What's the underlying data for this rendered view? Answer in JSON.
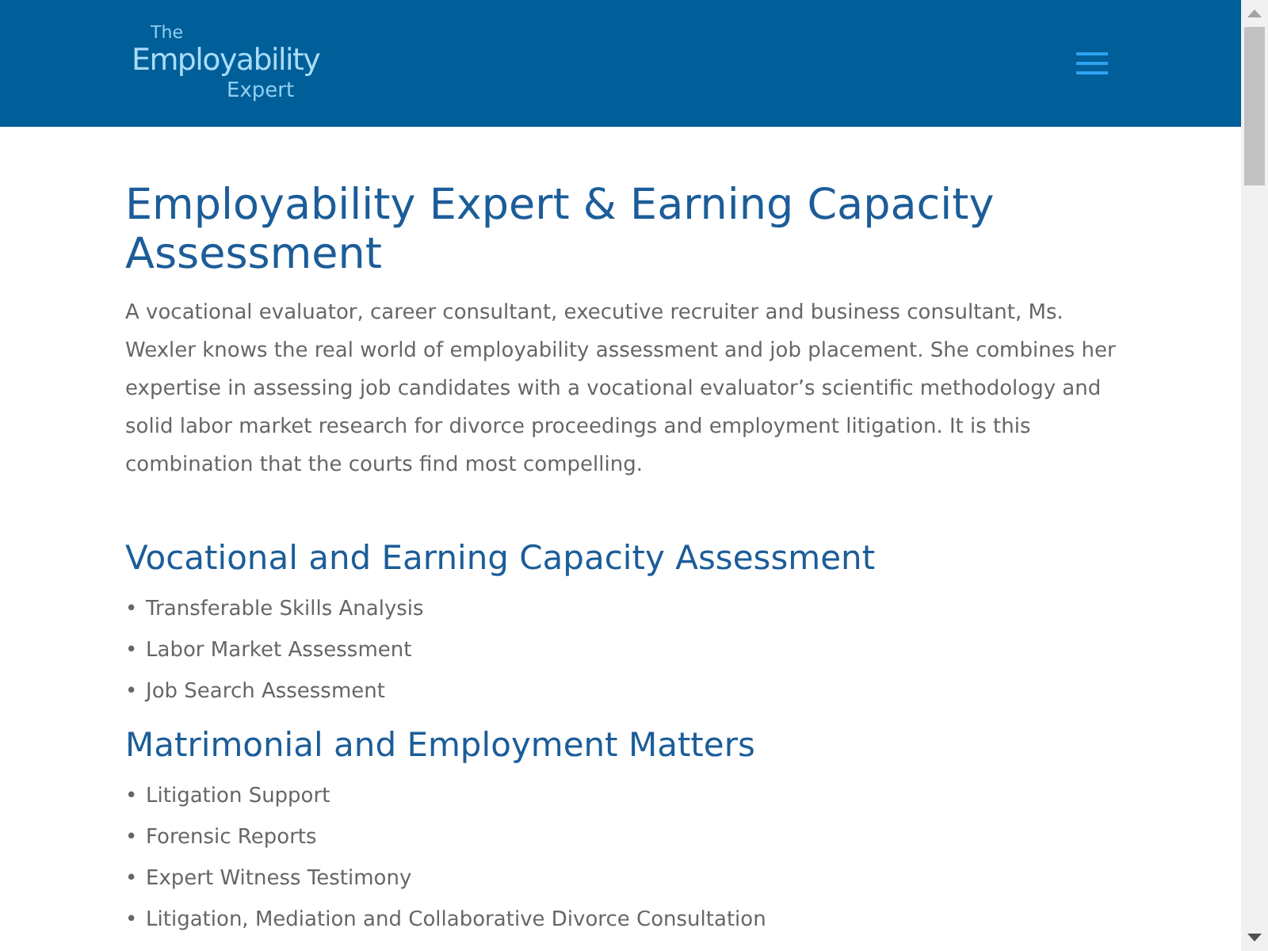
{
  "header": {
    "logo": {
      "line_1": "The",
      "line_2": "Employability",
      "line_3": "Expert"
    }
  },
  "page": {
    "title": "Employability Expert & Earning Capacity Assessment",
    "intro": "A vocational evaluator, career consultant, executive recruiter and business consultant, Ms. Wexler knows the real world of employability assessment and job placement. She combines her expertise in assessing job candidates with a vocational evaluator’s scientific methodology and solid labor market research for divorce proceedings and employment litigation. It is this combination that the courts find most compelling.",
    "sections": [
      {
        "heading": "Vocational and Earning Capacity Assessment",
        "items": [
          {
            "bullet": "•",
            "text": "Transferable Skills Analysis"
          },
          {
            "bullet": "•",
            "text": "Labor Market Assessment"
          },
          {
            "bullet": "•",
            "text": "Job Search Assessment"
          }
        ]
      },
      {
        "heading": "Matrimonial and Employment Matters",
        "items": [
          {
            "bullet": "•",
            "text": "Litigation Support"
          },
          {
            "bullet": "•",
            "text": "Forensic Reports"
          },
          {
            "bullet": "•",
            "text": "Expert Witness Testimony"
          },
          {
            "bullet": "•",
            "text": "Litigation, Mediation and Collaborative Divorce Consultation"
          }
        ]
      }
    ]
  }
}
